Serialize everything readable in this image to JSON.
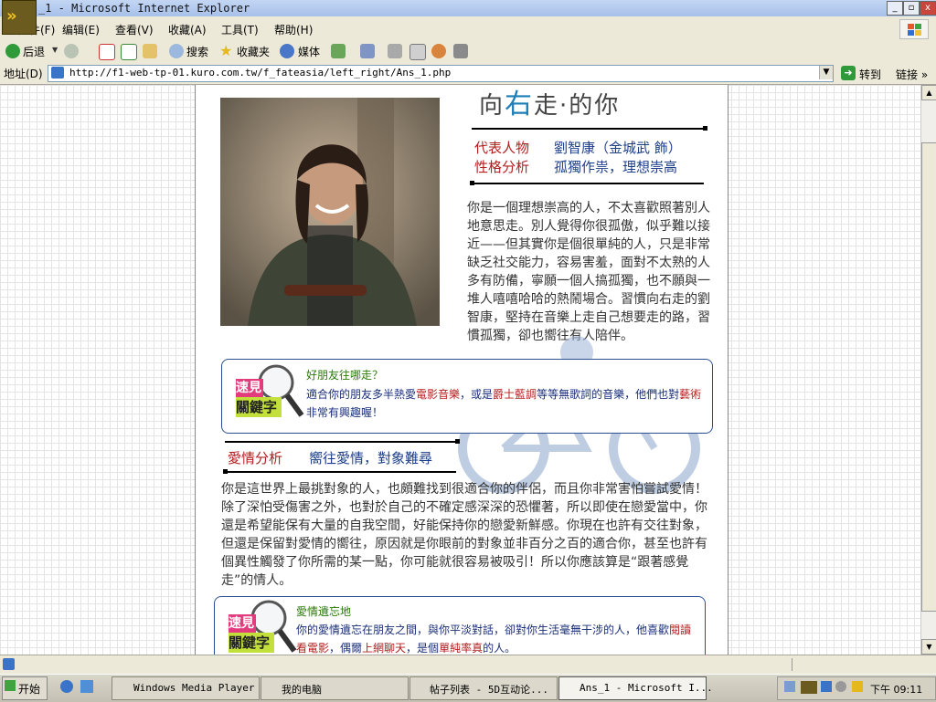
{
  "window": {
    "title": "_1 - Microsoft Internet Explorer",
    "minimize": "_",
    "maximize": "▫",
    "close": "x"
  },
  "menu": {
    "items": [
      "文件(F)",
      "编辑(E)",
      "查看(V)",
      "收藏(A)",
      "工具(T)",
      "帮助(H)"
    ]
  },
  "toolbar": {
    "back": "后退",
    "search": "搜索",
    "favorites": "收藏夹",
    "media": "媒体"
  },
  "address": {
    "label": "地址(D)",
    "url": "http://f1-web-tp-01.kuro.com.tw/f_fateasia/left_right/Ans_1.php",
    "go": "转到",
    "links": "链接 »"
  },
  "page": {
    "heading_prefix": "向",
    "heading_big": "右",
    "heading_suffix": "走·的你",
    "rep_label": "代表人物",
    "rep_value": "劉智康（金城武 飾）",
    "personality_label": "性格分析",
    "personality_value": "孤獨作祟，理想崇高",
    "description": "你是一個理想崇高的人，不太喜歡照著別人地意思走。別人覺得你很孤傲，似乎難以接近——但其實你是個很單純的人，只是非常缺乏社交能力，容易害羞，面對不太熟的人多有防備，寧願一個人搞孤獨，也不願與一堆人嘻嘻哈哈的熱鬧場合。習慣向右走的劉智康，堅持在音樂上走自己想要走的路，習慣孤獨，卻也嚮往有人陪伴。",
    "keybox1": {
      "badge_top": "速見",
      "badge_bottom": "關鍵字",
      "title": "好朋友往哪走？",
      "text_1": "適合你的朋友多半熱愛",
      "highlight_1": "電影音樂",
      "text_2": "，或是",
      "highlight_2": "爵士藍調",
      "text_3": "等等無歌詞的音樂，他們也對",
      "highlight_3": "藝術",
      "text_4": "非常有興趣喔！"
    },
    "love_label": "愛情分析",
    "love_value": "嚮往愛情，對象難尋",
    "love_text": "你是這世界上最挑對象的人，也頗難找到很適合你的伴侶，而且你非常害怕嘗試愛情！除了深怕受傷害之外，也對於自己的不確定感深深的恐懼著，所以即使在戀愛當中，你還是希望能保有大量的自我空間，好能保持你的戀愛新鮮感。你現在也許有交往對象，但還是保留對愛情的嚮往，原因就是你眼前的對象並非百分之百的適合你，甚至也許有個異性觸發了你所需的某一點，你可能就很容易被吸引！所以你應該算是“跟著感覺走”的情人。",
    "keybox2": {
      "badge_top": "速見",
      "badge_bottom": "關鍵字",
      "title": "愛情遺忘地",
      "text_1": "你的愛情遺忘在朋友之間，與你平淡對話，卻對你生活毫無干涉的人，他喜歡",
      "highlight_1": "閱讀",
      "highlight_2": "看電影",
      "text_2": "，偶爾",
      "highlight_3": "上網聊天",
      "text_3": "，是個",
      "highlight_4": "單純率真",
      "text_4": "的人。"
    }
  },
  "taskbar": {
    "start": "开始",
    "tasks": [
      "Windows Media Player",
      "我的电脑",
      "帖子列表 - 5D互动论...",
      "Ans_1 - Microsoft I..."
    ],
    "clock": "下午 09:11"
  },
  "colors": {
    "accent_red": "#b41e1e",
    "accent_blue": "#1d3f8a",
    "keybox_border": "#2d4f91",
    "heading_blue": "#1d7fb6"
  },
  "icons": [
    "back-icon",
    "forward-icon",
    "stop-icon",
    "refresh-icon",
    "home-icon",
    "search-icon",
    "favorites-icon",
    "media-icon",
    "history-icon",
    "mail-icon",
    "print-icon",
    "edit-icon",
    "messenger-icon",
    "go-icon",
    "windows-logo-icon",
    "magnifier-icon",
    "bicycle-watermark-icon",
    "ie-icon"
  ]
}
